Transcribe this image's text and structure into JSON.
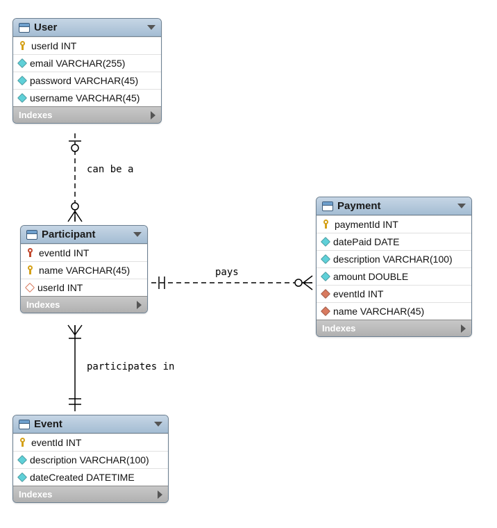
{
  "entities": {
    "user": {
      "title": "User",
      "columns": [
        {
          "icon": "pk",
          "label": "userId INT"
        },
        {
          "icon": "cyan-diamond",
          "label": "email VARCHAR(255)"
        },
        {
          "icon": "cyan-diamond",
          "label": "password VARCHAR(45)"
        },
        {
          "icon": "cyan-diamond",
          "label": "username VARCHAR(45)"
        }
      ],
      "indexes_label": "Indexes"
    },
    "participant": {
      "title": "Participant",
      "columns": [
        {
          "icon": "pk-red",
          "label": "eventId INT"
        },
        {
          "icon": "pk",
          "label": "name VARCHAR(45)"
        },
        {
          "icon": "red-open-diamond",
          "label": "userId INT"
        }
      ],
      "indexes_label": "Indexes"
    },
    "event": {
      "title": "Event",
      "columns": [
        {
          "icon": "pk",
          "label": "eventId INT"
        },
        {
          "icon": "cyan-diamond",
          "label": "description VARCHAR(100)"
        },
        {
          "icon": "cyan-diamond",
          "label": "dateCreated DATETIME"
        }
      ],
      "indexes_label": "Indexes"
    },
    "payment": {
      "title": "Payment",
      "columns": [
        {
          "icon": "pk",
          "label": "paymentId INT"
        },
        {
          "icon": "cyan-diamond",
          "label": "datePaid DATE"
        },
        {
          "icon": "cyan-diamond",
          "label": "description VARCHAR(100)"
        },
        {
          "icon": "cyan-diamond",
          "label": "amount DOUBLE"
        },
        {
          "icon": "red-diamond",
          "label": "eventId INT"
        },
        {
          "icon": "red-diamond",
          "label": "name VARCHAR(45)"
        }
      ],
      "indexes_label": "Indexes"
    }
  },
  "relationships": {
    "can_be_a": "can be a",
    "pays": "pays",
    "participates_in": "participates in"
  }
}
